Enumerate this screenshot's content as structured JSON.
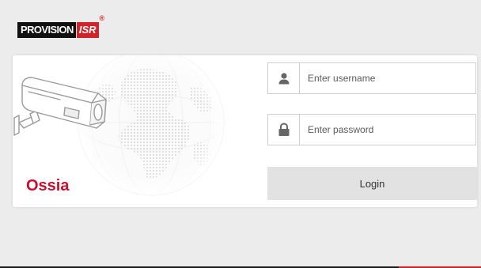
{
  "logo": {
    "main_text": "PROVISION",
    "isr_text": "ISR",
    "registered_mark": "®"
  },
  "brand": {
    "name": "Ossia"
  },
  "login_form": {
    "username_placeholder": "Enter username",
    "username_value": "",
    "password_placeholder": "Enter password",
    "password_value": "",
    "login_label": "Login"
  },
  "icons": {
    "username": "user-icon",
    "password": "lock-icon",
    "illustration": "security-camera-icon"
  },
  "colors": {
    "brand_red": "#c8102e",
    "logo_red": "#d2232a",
    "logo_black": "#111111",
    "background": "#ececec",
    "button_bg": "#e2e2e2"
  }
}
